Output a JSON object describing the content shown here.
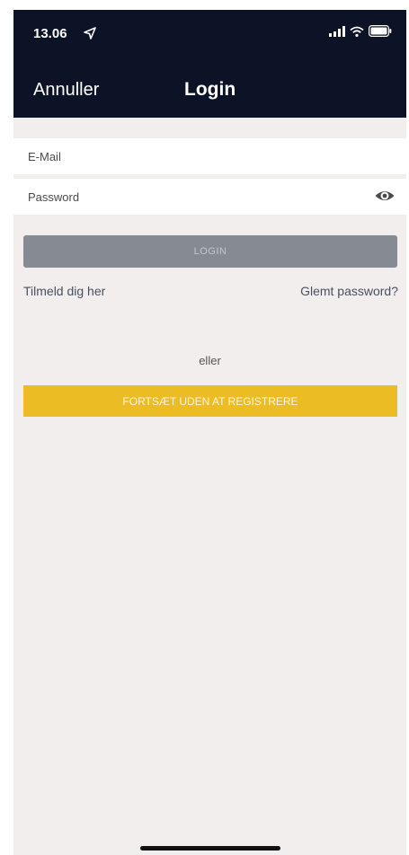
{
  "status_bar": {
    "time": "13.06",
    "location_icon": "location-arrow-icon",
    "signal_icon": "cellular-signal-icon",
    "wifi_icon": "wifi-icon",
    "battery_icon": "battery-icon"
  },
  "nav": {
    "cancel_label": "Annuller",
    "title": "Login"
  },
  "form": {
    "email_placeholder": "E-Mail",
    "email_value": "",
    "password_placeholder": "Password",
    "password_value": "",
    "password_toggle_icon": "eye-icon"
  },
  "actions": {
    "login_label": "LOGIN",
    "signup_link": "Tilmeld dig her",
    "forgot_link": "Glemt password?",
    "separator_text": "eller",
    "guest_label": "FORTSÆT UDEN AT REGISTRERE"
  },
  "colors": {
    "header_bg": "#0c1326",
    "login_button_bg": "#858a93",
    "guest_button_bg": "#ecbc24",
    "page_bg": "#f2eeed"
  }
}
